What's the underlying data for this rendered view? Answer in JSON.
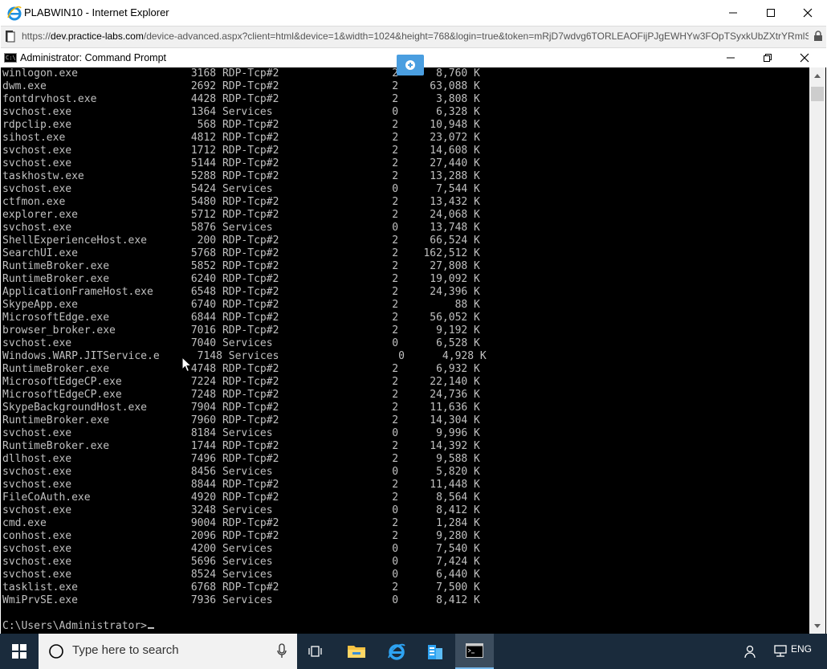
{
  "browser": {
    "window_title": "PLABWIN10 - Internet Explorer",
    "url_prefix": "https://",
    "url_host": "dev.practice-labs.com",
    "url_rest": "/device-advanced.aspx?client=html&device=1&width=1024&height=768&login=true&token=mRjD7wdvg6TORLEAOFijPJgEWHYw3FOpTSyxkUbZXtrYRmlS"
  },
  "cmd": {
    "window_title": "Administrator: Command Prompt",
    "icon_label": "C:\\",
    "prompt": "C:\\Users\\Administrator>"
  },
  "processes": [
    {
      "name": "winlogon.exe",
      "pid": "3168",
      "session_name": "RDP-Tcp#2",
      "session_num": "2",
      "mem": "8,760 K"
    },
    {
      "name": "dwm.exe",
      "pid": "2692",
      "session_name": "RDP-Tcp#2",
      "session_num": "2",
      "mem": "63,088 K"
    },
    {
      "name": "fontdrvhost.exe",
      "pid": "4428",
      "session_name": "RDP-Tcp#2",
      "session_num": "2",
      "mem": "3,808 K"
    },
    {
      "name": "svchost.exe",
      "pid": "1364",
      "session_name": "Services",
      "session_num": "0",
      "mem": "6,328 K"
    },
    {
      "name": "rdpclip.exe",
      "pid": "568",
      "session_name": "RDP-Tcp#2",
      "session_num": "2",
      "mem": "10,948 K"
    },
    {
      "name": "sihost.exe",
      "pid": "4812",
      "session_name": "RDP-Tcp#2",
      "session_num": "2",
      "mem": "23,072 K"
    },
    {
      "name": "svchost.exe",
      "pid": "1712",
      "session_name": "RDP-Tcp#2",
      "session_num": "2",
      "mem": "14,608 K"
    },
    {
      "name": "svchost.exe",
      "pid": "5144",
      "session_name": "RDP-Tcp#2",
      "session_num": "2",
      "mem": "27,440 K"
    },
    {
      "name": "taskhostw.exe",
      "pid": "5288",
      "session_name": "RDP-Tcp#2",
      "session_num": "2",
      "mem": "13,288 K"
    },
    {
      "name": "svchost.exe",
      "pid": "5424",
      "session_name": "Services",
      "session_num": "0",
      "mem": "7,544 K"
    },
    {
      "name": "ctfmon.exe",
      "pid": "5480",
      "session_name": "RDP-Tcp#2",
      "session_num": "2",
      "mem": "13,432 K"
    },
    {
      "name": "explorer.exe",
      "pid": "5712",
      "session_name": "RDP-Tcp#2",
      "session_num": "2",
      "mem": "24,068 K"
    },
    {
      "name": "svchost.exe",
      "pid": "5876",
      "session_name": "Services",
      "session_num": "0",
      "mem": "13,748 K"
    },
    {
      "name": "ShellExperienceHost.exe",
      "pid": "200",
      "session_name": "RDP-Tcp#2",
      "session_num": "2",
      "mem": "66,524 K"
    },
    {
      "name": "SearchUI.exe",
      "pid": "5768",
      "session_name": "RDP-Tcp#2",
      "session_num": "2",
      "mem": "162,512 K"
    },
    {
      "name": "RuntimeBroker.exe",
      "pid": "5852",
      "session_name": "RDP-Tcp#2",
      "session_num": "2",
      "mem": "27,808 K"
    },
    {
      "name": "RuntimeBroker.exe",
      "pid": "6240",
      "session_name": "RDP-Tcp#2",
      "session_num": "2",
      "mem": "19,092 K"
    },
    {
      "name": "ApplicationFrameHost.exe",
      "pid": "6548",
      "session_name": "RDP-Tcp#2",
      "session_num": "2",
      "mem": "24,396 K"
    },
    {
      "name": "SkypeApp.exe",
      "pid": "6740",
      "session_name": "RDP-Tcp#2",
      "session_num": "2",
      "mem": "88 K"
    },
    {
      "name": "MicrosoftEdge.exe",
      "pid": "6844",
      "session_name": "RDP-Tcp#2",
      "session_num": "2",
      "mem": "56,052 K"
    },
    {
      "name": "browser_broker.exe",
      "pid": "7016",
      "session_name": "RDP-Tcp#2",
      "session_num": "2",
      "mem": "9,192 K"
    },
    {
      "name": "svchost.exe",
      "pid": "7040",
      "session_name": "Services",
      "session_num": "0",
      "mem": "6,528 K"
    },
    {
      "name": "Windows.WARP.JITService.e",
      "pid": "7148",
      "session_name": "Services",
      "session_num": "0",
      "mem": "4,928 K"
    },
    {
      "name": "RuntimeBroker.exe",
      "pid": "4748",
      "session_name": "RDP-Tcp#2",
      "session_num": "2",
      "mem": "6,932 K"
    },
    {
      "name": "MicrosoftEdgeCP.exe",
      "pid": "7224",
      "session_name": "RDP-Tcp#2",
      "session_num": "2",
      "mem": "22,140 K"
    },
    {
      "name": "MicrosoftEdgeCP.exe",
      "pid": "7248",
      "session_name": "RDP-Tcp#2",
      "session_num": "2",
      "mem": "24,736 K"
    },
    {
      "name": "SkypeBackgroundHost.exe",
      "pid": "7904",
      "session_name": "RDP-Tcp#2",
      "session_num": "2",
      "mem": "11,636 K"
    },
    {
      "name": "RuntimeBroker.exe",
      "pid": "7960",
      "session_name": "RDP-Tcp#2",
      "session_num": "2",
      "mem": "14,304 K"
    },
    {
      "name": "svchost.exe",
      "pid": "8184",
      "session_name": "Services",
      "session_num": "0",
      "mem": "9,996 K"
    },
    {
      "name": "RuntimeBroker.exe",
      "pid": "1744",
      "session_name": "RDP-Tcp#2",
      "session_num": "2",
      "mem": "14,392 K"
    },
    {
      "name": "dllhost.exe",
      "pid": "7496",
      "session_name": "RDP-Tcp#2",
      "session_num": "2",
      "mem": "9,588 K"
    },
    {
      "name": "svchost.exe",
      "pid": "8456",
      "session_name": "Services",
      "session_num": "0",
      "mem": "5,820 K"
    },
    {
      "name": "svchost.exe",
      "pid": "8844",
      "session_name": "RDP-Tcp#2",
      "session_num": "2",
      "mem": "11,448 K"
    },
    {
      "name": "FileCoAuth.exe",
      "pid": "4920",
      "session_name": "RDP-Tcp#2",
      "session_num": "2",
      "mem": "8,564 K"
    },
    {
      "name": "svchost.exe",
      "pid": "3248",
      "session_name": "Services",
      "session_num": "0",
      "mem": "8,412 K"
    },
    {
      "name": "cmd.exe",
      "pid": "9004",
      "session_name": "RDP-Tcp#2",
      "session_num": "2",
      "mem": "1,284 K"
    },
    {
      "name": "conhost.exe",
      "pid": "2096",
      "session_name": "RDP-Tcp#2",
      "session_num": "2",
      "mem": "9,280 K"
    },
    {
      "name": "svchost.exe",
      "pid": "4200",
      "session_name": "Services",
      "session_num": "0",
      "mem": "7,540 K"
    },
    {
      "name": "svchost.exe",
      "pid": "5696",
      "session_name": "Services",
      "session_num": "0",
      "mem": "7,424 K"
    },
    {
      "name": "svchost.exe",
      "pid": "8524",
      "session_name": "Services",
      "session_num": "0",
      "mem": "6,440 K"
    },
    {
      "name": "tasklist.exe",
      "pid": "6768",
      "session_name": "RDP-Tcp#2",
      "session_num": "2",
      "mem": "7,500 K"
    },
    {
      "name": "WmiPrvSE.exe",
      "pid": "7936",
      "session_name": "Services",
      "session_num": "0",
      "mem": "8,412 K"
    }
  ],
  "taskbar": {
    "search_placeholder": "Type here to search",
    "language": "ENG",
    "pinned": [
      {
        "icon": "task-view-icon"
      },
      {
        "icon": "file-explorer-icon"
      },
      {
        "icon": "internet-explorer-icon"
      },
      {
        "icon": "server-manager-icon"
      },
      {
        "icon": "command-prompt-icon",
        "active": true
      }
    ]
  },
  "colors": {
    "console_bg": "#000000",
    "console_fg": "#c0c0c0",
    "taskbar_bg": "#1a2b3c",
    "ie_blue": "#1e90e0"
  }
}
